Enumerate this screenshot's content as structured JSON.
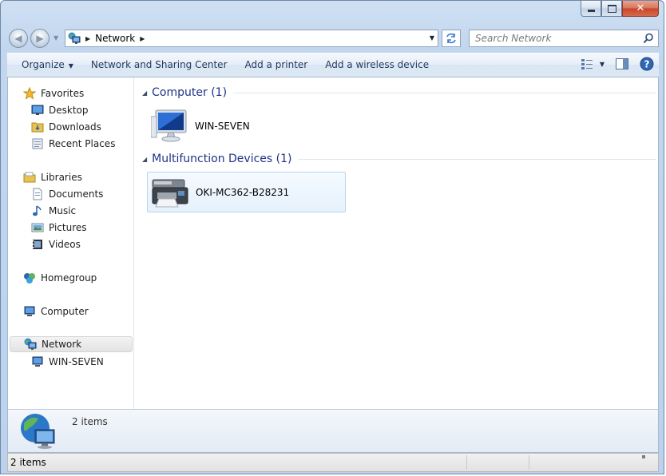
{
  "window": {
    "caption_buttons": {
      "minimize_icon": "minimize-icon",
      "maximize_icon": "maximize-icon",
      "close_glyph": "✕"
    }
  },
  "address_bar": {
    "location_icon": "network-icon",
    "path": [
      "Network"
    ]
  },
  "search": {
    "placeholder": "Search Network"
  },
  "toolbar": {
    "organize_label": "Organize",
    "items": [
      "Network and Sharing Center",
      "Add a printer",
      "Add a wireless device"
    ],
    "right_icons": [
      "view-options-icon",
      "preview-pane-icon",
      "help-icon"
    ]
  },
  "sidebar": {
    "favorites": {
      "label": "Favorites",
      "items": [
        "Desktop",
        "Downloads",
        "Recent Places"
      ]
    },
    "libraries": {
      "label": "Libraries",
      "items": [
        "Documents",
        "Music",
        "Pictures",
        "Videos"
      ]
    },
    "homegroup": "Homegroup",
    "computer": "Computer",
    "network": {
      "label": "Network",
      "items": [
        "WIN-SEVEN"
      ]
    }
  },
  "main": {
    "groups": [
      {
        "title": "Computer (1)",
        "items": [
          {
            "name": "WIN-SEVEN",
            "icon": "computer-icon"
          }
        ]
      },
      {
        "title": "Multifunction Devices (1)",
        "items": [
          {
            "name": "OKI-MC362-B28231",
            "icon": "printer-icon"
          }
        ]
      }
    ]
  },
  "details_pane": {
    "text": "2 items",
    "icon": "network-globe-icon"
  },
  "status_bar": {
    "text": "2 items"
  }
}
